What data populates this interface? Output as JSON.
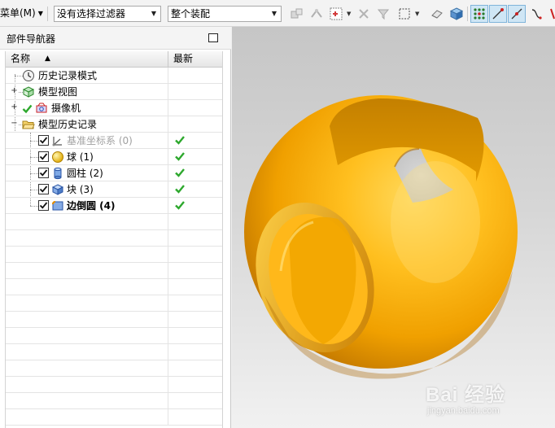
{
  "toolbar": {
    "menu_label": "菜单(M)",
    "selection_filter": "没有选择过滤器",
    "assembly_scope": "整个装配"
  },
  "navigator": {
    "title": "部件导航器",
    "columns": {
      "name": "名称",
      "latest": "最新"
    },
    "items": [
      {
        "label": "历史记录模式",
        "icon": "history-clock-icon",
        "latest": false
      },
      {
        "label": "模型视图",
        "icon": "model-views-icon",
        "latest": false
      },
      {
        "label": "摄像机",
        "icon": "camera-icon",
        "latest": false
      },
      {
        "label": "模型历史记录",
        "icon": "folder-open-icon",
        "latest": false
      },
      {
        "label": "基准坐标系 (0)",
        "icon": "datum-csys-icon",
        "checked": true,
        "latest": true
      },
      {
        "label": "球 (1)",
        "icon": "sphere-icon",
        "checked": true,
        "latest": true
      },
      {
        "label": "圆柱 (2)",
        "icon": "cylinder-icon",
        "checked": true,
        "latest": true
      },
      {
        "label": "块 (3)",
        "icon": "block-icon",
        "checked": true,
        "latest": true
      },
      {
        "label": "边倒圆 (4)",
        "icon": "edge-blend-icon",
        "checked": true,
        "latest": true
      }
    ]
  },
  "viewport": {
    "model_color": "#F5A800",
    "watermark": {
      "text": "Bai 经验",
      "subtext": "jingyan.baidu.com"
    }
  },
  "colors": {
    "check_green": "#2da82d",
    "selected_tool_bg": "#cfe6f5"
  }
}
